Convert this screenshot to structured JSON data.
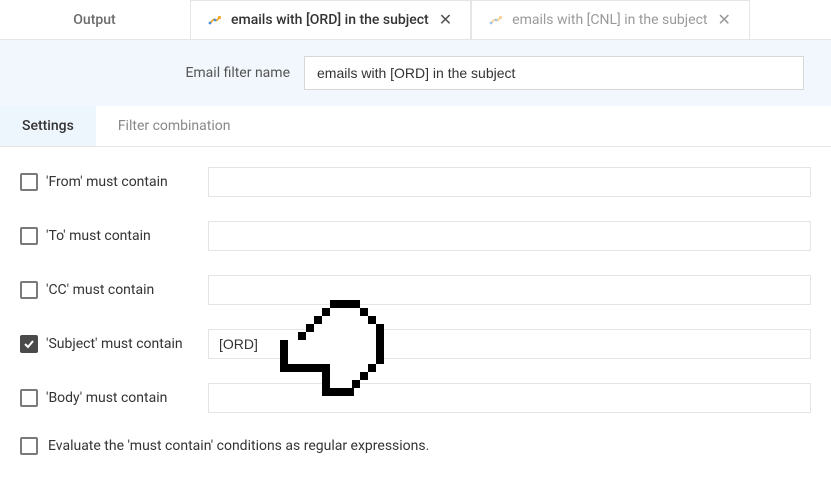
{
  "tabs": {
    "output": "Output",
    "active": {
      "label": "emails with [ORD] in the subject"
    },
    "inactive": {
      "label": "emails with [CNL] in the subject"
    }
  },
  "name_field": {
    "label": "Email filter name",
    "value": "emails with [ORD] in the subject"
  },
  "subtabs": {
    "settings": "Settings",
    "filter_combination": "Filter combination"
  },
  "rows": {
    "from": {
      "label": "'From' must contain",
      "checked": false,
      "value": ""
    },
    "to": {
      "label": "'To' must contain",
      "checked": false,
      "value": ""
    },
    "cc": {
      "label": "'CC' must contain",
      "checked": false,
      "value": ""
    },
    "subject": {
      "label": "'Subject' must contain",
      "checked": true,
      "value": "[ORD]"
    },
    "body": {
      "label": "'Body' must contain",
      "checked": false,
      "value": ""
    }
  },
  "regex": {
    "label": "Evaluate the 'must contain' conditions as regular expressions.",
    "checked": false
  }
}
